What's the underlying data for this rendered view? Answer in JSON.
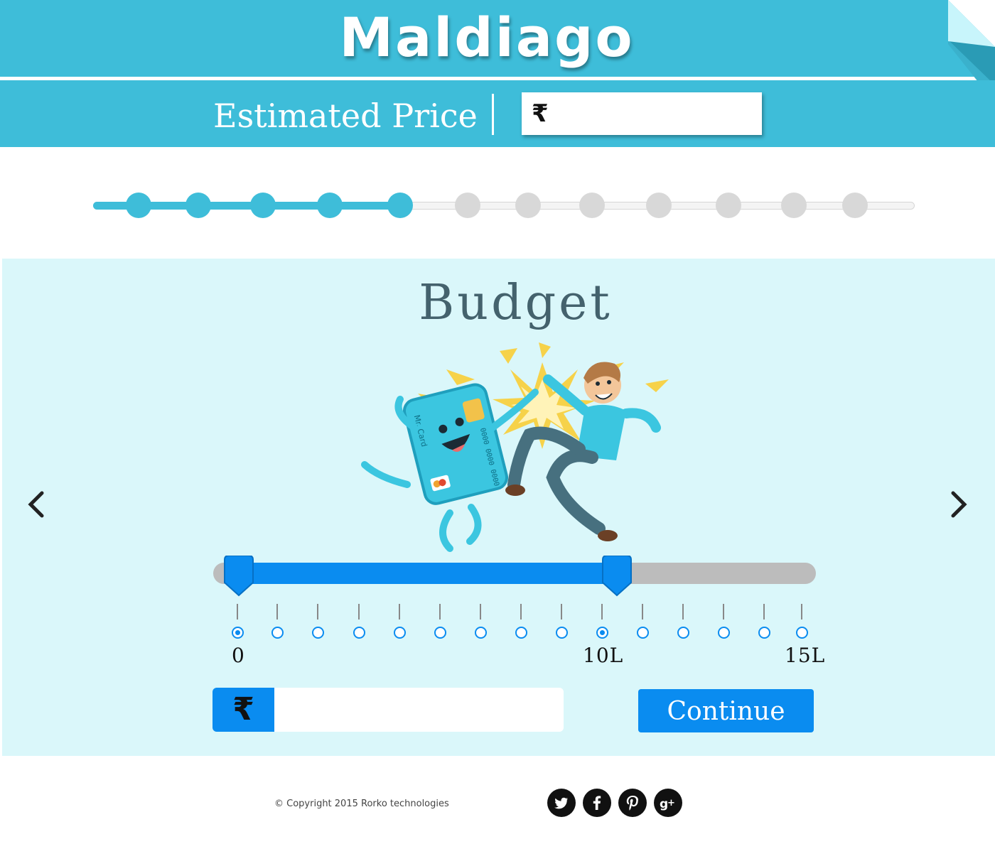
{
  "header": {
    "logo": "Maldiago"
  },
  "price": {
    "label": "Estimated Price",
    "currency_symbol": "₹",
    "value": ""
  },
  "progress": {
    "total_steps": 12,
    "completed_steps": 5
  },
  "budget": {
    "title": "Budget",
    "nav": {
      "prev_icon": "chevron-left-icon",
      "next_icon": "chevron-right-icon"
    },
    "illustration": "card-high-five-illustration",
    "illustration_text": [
      "Mr. Card",
      "0000 0000 0000"
    ],
    "slider": {
      "min_label": "0",
      "mid_label": "10L",
      "max_label": "15L",
      "selected_min": "0",
      "selected_max": "10L"
    },
    "amount": {
      "currency_symbol": "₹",
      "value": "",
      "placeholder": ""
    },
    "continue_label": "Continue"
  },
  "footer": {
    "copyright": "© Copyright 2015 Rorko technologies",
    "social": [
      "twitter-icon",
      "facebook-icon",
      "pinterest-icon",
      "google-plus-icon"
    ]
  },
  "colors": {
    "brand": "#3ebdd9",
    "accent": "#0a8cf0",
    "panel_bg": "#daf7fa",
    "title_text": "#44626d"
  }
}
